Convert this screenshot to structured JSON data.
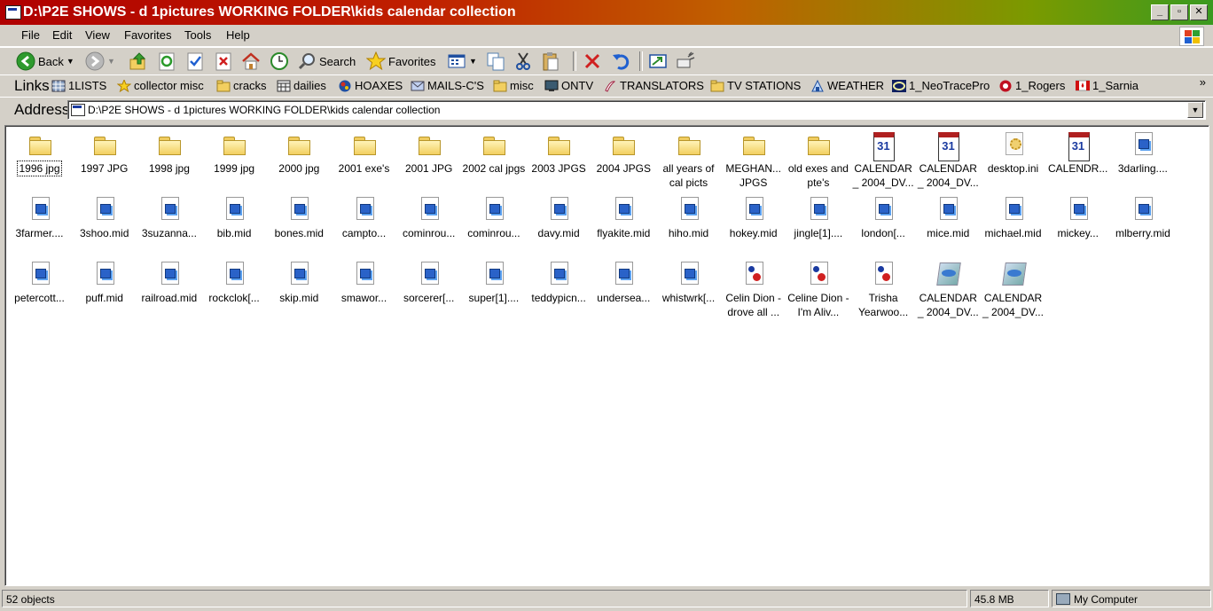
{
  "window": {
    "title": "D:\\P2E SHOWS - d 1pictures WORKING FOLDER\\kids calendar collection",
    "controls": [
      "_",
      "▫",
      "✕"
    ]
  },
  "menu": {
    "items": [
      {
        "label": "File",
        "key": "F",
        "rest": "ile"
      },
      {
        "label": "Edit",
        "key": "E",
        "rest": "dit"
      },
      {
        "label": "View",
        "key": "V",
        "rest": "iew"
      },
      {
        "label": "Favorites",
        "key": "a",
        "pre": "F",
        "rest": "vorites"
      },
      {
        "label": "Tools",
        "key": "T",
        "rest": "ools"
      },
      {
        "label": "Help",
        "key": "H",
        "rest": "elp"
      }
    ]
  },
  "toolbar": {
    "back_label": "Back",
    "search_label": "Search",
    "favorites_label": "Favorites"
  },
  "links": {
    "label": "Links",
    "items": [
      {
        "label": "1LISTS",
        "icon": "grid-icon"
      },
      {
        "label": "collector misc",
        "icon": "star-icon"
      },
      {
        "label": "cracks",
        "icon": "folder-icon"
      },
      {
        "label": "dailies",
        "icon": "calendar-icon"
      },
      {
        "label": "HOAXES",
        "icon": "globe-icon"
      },
      {
        "label": "MAILS-C'S",
        "icon": "mail-icon"
      },
      {
        "label": "misc",
        "icon": "folder-icon"
      },
      {
        "label": "ONTV",
        "icon": "tv-icon"
      },
      {
        "label": "TRANSLATORS",
        "icon": "script-icon"
      },
      {
        "label": "TV STATIONS",
        "icon": "folder-icon"
      },
      {
        "label": "WEATHER",
        "icon": "weather-icon"
      },
      {
        "label": "1_NeoTracePro",
        "icon": "neotrace-icon"
      },
      {
        "label": "1_Rogers",
        "icon": "rogers-icon"
      },
      {
        "label": "1_Sarnia",
        "icon": "canada-flag-icon"
      }
    ],
    "more": "»"
  },
  "address": {
    "label": "Address",
    "path": "D:\\P2E SHOWS - d 1pictures WORKING FOLDER\\kids calendar collection"
  },
  "files": [
    {
      "name": "1996 jpg",
      "type": "folder",
      "selected": true
    },
    {
      "name": "1997 JPG",
      "type": "folder"
    },
    {
      "name": "1998 jpg",
      "type": "folder"
    },
    {
      "name": "1999 jpg",
      "type": "folder"
    },
    {
      "name": "2000 jpg",
      "type": "folder"
    },
    {
      "name": "2001 exe's",
      "type": "folder"
    },
    {
      "name": "2001 JPG",
      "type": "folder"
    },
    {
      "name": "2002 cal jpgs",
      "type": "folder"
    },
    {
      "name": "2003 JPGS",
      "type": "folder"
    },
    {
      "name": "2004 JPGS",
      "type": "folder"
    },
    {
      "name": "all years of cal  picts",
      "type": "folder"
    },
    {
      "name": "MEGHAN... JPGS",
      "type": "folder"
    },
    {
      "name": "old exes and pte's",
      "type": "folder"
    },
    {
      "name": "CALENDAR_ 2004_DV...",
      "type": "cal"
    },
    {
      "name": "CALENDAR_ 2004_DV...",
      "type": "cal"
    },
    {
      "name": "desktop.ini",
      "type": "ini"
    },
    {
      "name": "CALENDR...",
      "type": "cal"
    },
    {
      "name": "3darling....",
      "type": "midi"
    },
    {
      "name": "3farmer....",
      "type": "midi"
    },
    {
      "name": "3shoo.mid",
      "type": "midi"
    },
    {
      "name": "3suzanna...",
      "type": "midi"
    },
    {
      "name": "bib.mid",
      "type": "midi"
    },
    {
      "name": "bones.mid",
      "type": "midi"
    },
    {
      "name": "campto...",
      "type": "midi"
    },
    {
      "name": "cominrou...",
      "type": "midi"
    },
    {
      "name": "cominrou...",
      "type": "midi"
    },
    {
      "name": "davy.mid",
      "type": "midi"
    },
    {
      "name": "flyakite.mid",
      "type": "midi"
    },
    {
      "name": "hiho.mid",
      "type": "midi"
    },
    {
      "name": "hokey.mid",
      "type": "midi"
    },
    {
      "name": "jingle[1]....",
      "type": "midi"
    },
    {
      "name": "london[...",
      "type": "midi"
    },
    {
      "name": "mice.mid",
      "type": "midi"
    },
    {
      "name": "michael.mid",
      "type": "midi"
    },
    {
      "name": "mickey...",
      "type": "midi"
    },
    {
      "name": "mlberry.mid",
      "type": "midi"
    },
    {
      "name": "petercott...",
      "type": "midi"
    },
    {
      "name": "puff.mid",
      "type": "midi"
    },
    {
      "name": "railroad.mid",
      "type": "midi"
    },
    {
      "name": "rockclok[...",
      "type": "midi"
    },
    {
      "name": "skip.mid",
      "type": "midi"
    },
    {
      "name": "smawor...",
      "type": "midi"
    },
    {
      "name": "sorcerer[...",
      "type": "midi"
    },
    {
      "name": "super[1]....",
      "type": "midi"
    },
    {
      "name": "teddypicn...",
      "type": "midi"
    },
    {
      "name": "undersea...",
      "type": "midi"
    },
    {
      "name": "whistwrk[...",
      "type": "midi"
    },
    {
      "name": "Celin Dion - drove all ...",
      "type": "mp3"
    },
    {
      "name": "Celine Dion - I'm Aliv...",
      "type": "mp3"
    },
    {
      "name": "Trisha Yearwoo...",
      "type": "mp3"
    },
    {
      "name": "CALENDAR_ 2004_DV...",
      "type": "bird"
    },
    {
      "name": "CALENDAR_ 2004_DV...",
      "type": "bird"
    }
  ],
  "status": {
    "objects": "52 objects",
    "size": "45.8 MB",
    "zone": "My Computer"
  }
}
